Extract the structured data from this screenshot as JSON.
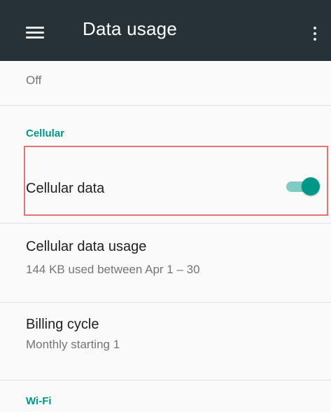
{
  "app_bar": {
    "title": "Data usage",
    "menu_icon": "hamburger-menu-icon",
    "overflow_icon": "more-vert-icon"
  },
  "top_partial": {
    "summary": "Off"
  },
  "cellular_section": {
    "header": "Cellular",
    "cellular_data": {
      "label": "Cellular data",
      "enabled": true
    },
    "cellular_data_usage": {
      "title": "Cellular data usage",
      "summary": "144 KB used between Apr 1 – 30"
    },
    "billing_cycle": {
      "title": "Billing cycle",
      "summary": "Monthly starting 1"
    }
  },
  "wifi_section": {
    "header": "Wi-Fi"
  },
  "colors": {
    "app_bar": "#263238",
    "accent": "#009688",
    "highlight": "#e57373"
  }
}
